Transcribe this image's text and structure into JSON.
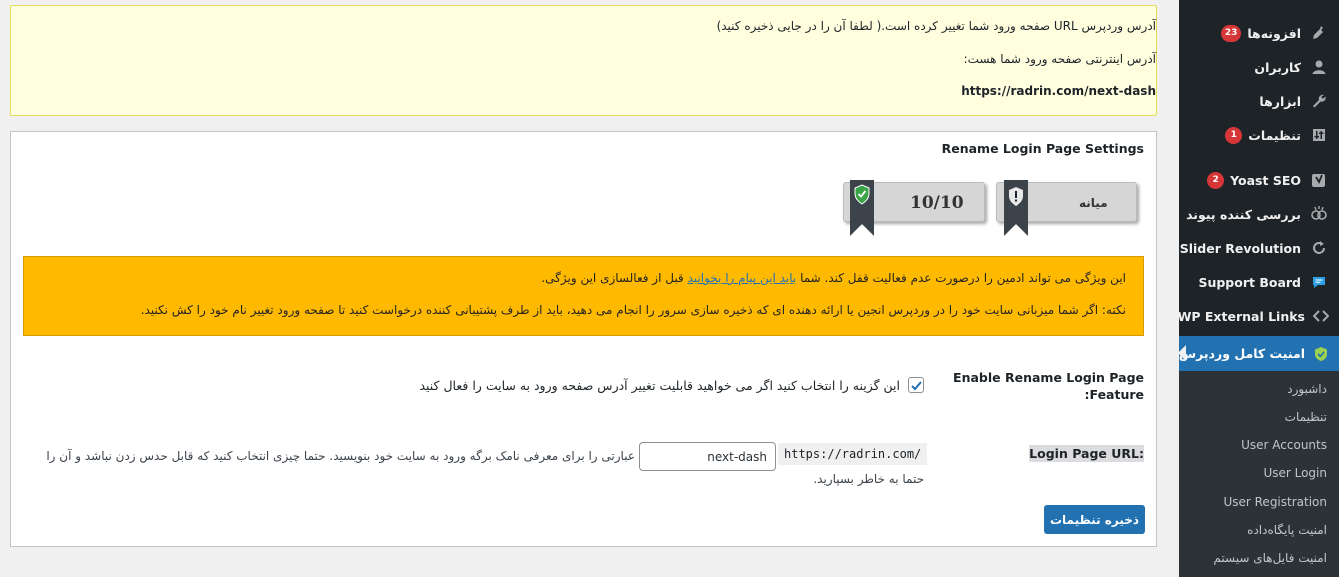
{
  "notice": {
    "line1": "آدرس وردپرس URL صفحه ورود شما تغییر کرده است.( لطفا آن را در جایی ذخیره کنید)",
    "line2": "آدرس اینترنتی صفحه ورود شما هست:",
    "url": "https://radrin.com/next-dash"
  },
  "settings": {
    "title": "Rename Login Page Settings",
    "score_value": "10/10",
    "score_level": "میانه",
    "warning_line1_pre": "این ویژگی می تواند ادمین را درصورت عدم فعالیت قفل کند. شما ",
    "warning_line1_link": "باید این پیام را بخوانید",
    "warning_line1_post": " قبل از فعالسازی این ویژگی.",
    "warning_line2": "نکته: اگر شما میزبانی سایت خود را در وردپرس انجین یا ارائه دهنده ای که ذخیره سازی سرور را انجام می دهید، باید از طرف پشتیبانی کننده درخواست کنید تا صفحه ورود تغییر نام خود را کش نکنید.",
    "feature_label_line1": "Enable Rename Login Page",
    "feature_label_line2": "Feature:",
    "feature_checkbox_text": "این گزینه را انتخاب کنید اگر می خواهید قابلیت تغییر آدرس صفحه ورود به سایت را فعال کنید",
    "feature_checked": true,
    "url_label": "Login Page URL:",
    "url_prefix": "https://radrin.com/",
    "url_value": "next-dash",
    "url_desc_line1": "عبارتی را برای معرفی نامک برگه ورود به سایت خود بنویسید. حتما چیزی انتخاب کنید که قابل حدس زدن نباشد و آن را",
    "url_desc_line2": "حتما به خاطر بسپارید.",
    "save_label": "ذخیره تنظیمات"
  },
  "sidebar": {
    "items": [
      {
        "label": "افزونه‌ها",
        "badge": "23",
        "icon": "plugin-icon"
      },
      {
        "label": "کاربران",
        "badge": "",
        "icon": "user-icon"
      },
      {
        "label": "ابزارها",
        "badge": "",
        "icon": "wrench-icon"
      },
      {
        "label": "تنظیمات",
        "badge": "1",
        "icon": "settings-icon"
      },
      {
        "label": "Yoast SEO",
        "badge": "2",
        "icon": "yoast-icon"
      },
      {
        "label": "بررسی کننده پیوند",
        "badge": "",
        "icon": "link-checker-icon"
      },
      {
        "label": "Slider Revolution",
        "badge": "",
        "icon": "refresh-icon"
      },
      {
        "label": "Support Board",
        "badge": "",
        "icon": "chat-icon"
      },
      {
        "label": "WP External Links",
        "badge": "",
        "icon": "code-arrows-icon"
      },
      {
        "label": "امنیت کامل وردپرس",
        "badge": "",
        "icon": "shield-icon"
      }
    ],
    "submenu": [
      "داشبورد",
      "تنظیمات",
      "User Accounts",
      "User Login",
      "User Registration",
      "امنیت پایگاه‌داده",
      "امنیت فایل‌های سیستم"
    ]
  },
  "colors": {
    "admin_bar": "#1d2327",
    "submenu_bg": "#2c3338",
    "accent": "#2271b1",
    "notice_bg": "#ffffe0",
    "warning_bg": "#ffba00",
    "badge": "#d63638"
  }
}
